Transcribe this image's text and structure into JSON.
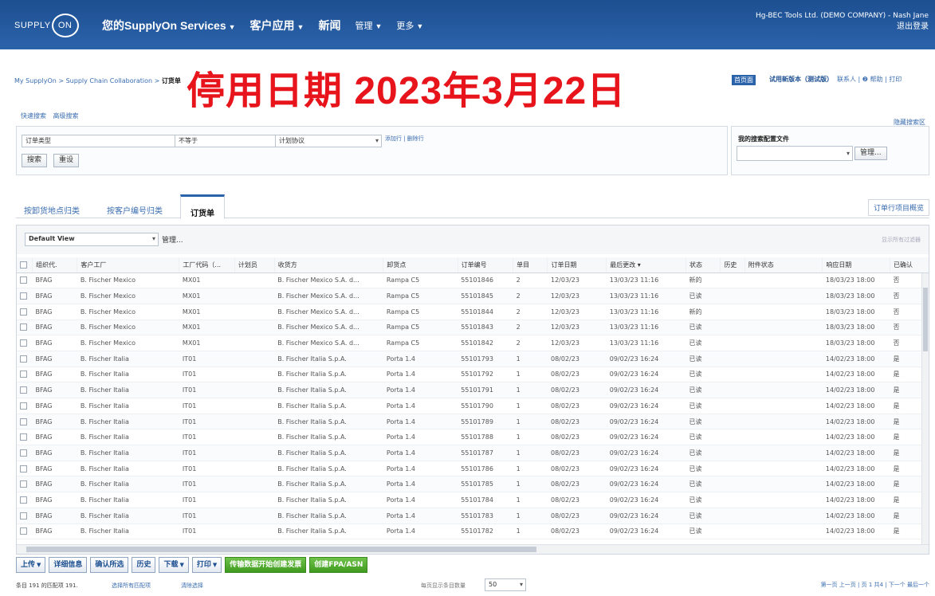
{
  "header": {
    "logo_text": "SUPPLY",
    "logo_ring": "ON",
    "nav": [
      {
        "label": "您的SupplyOn Services",
        "caret": "▼"
      },
      {
        "label": "客户应用",
        "caret": "▼"
      },
      {
        "label": "新闻",
        "caret": ""
      },
      {
        "label": "管理",
        "caret": "▼"
      },
      {
        "label": "更多",
        "caret": "▼"
      }
    ],
    "user": "Hg-BEC Tools Ltd. (DEMO COMPANY) - Nash Jane",
    "logout": "退出登录"
  },
  "breadcrumb": {
    "path": "My SupplyOn > Supply Chain Collaboration > ",
    "current": "订货单"
  },
  "banner": "停用日期 2023年3月22日",
  "crumb_right": {
    "home": "首页面",
    "trial": "试用新版本（测试版）",
    "links": "联系人 | ❷ 帮助 | 打印"
  },
  "search_tabs": [
    "快速搜索",
    "高级搜索"
  ],
  "saved_search": "隐藏搜索区",
  "filter": {
    "field": "订单类型",
    "operator": "不等于",
    "value": "计划协议",
    "add_remove": "添加行 | 删除行",
    "search_btn": "搜索",
    "reset_btn": "重设"
  },
  "profile": {
    "label": "我的搜索配置文件",
    "value": "",
    "manage": "管理..."
  },
  "tabs": [
    {
      "label": "按卸货地点归类"
    },
    {
      "label": "按客户编号归类"
    },
    {
      "label": "订货单"
    }
  ],
  "order_lines_btn": "订单行项目概览",
  "view": {
    "selected": "Default View",
    "manage": "管理...",
    "right_hint": "显示所有过滤器"
  },
  "columns": [
    "组织代.",
    "客户工厂",
    "工厂代码（...",
    "计划员",
    "收货方",
    "卸货点",
    "订单编号",
    "单目",
    "订单日期",
    "最后更改 ▾",
    "状态",
    "历史",
    "附件状态",
    "响应日期",
    "已确认"
  ],
  "rows": [
    [
      "BFAG",
      "B. Fischer Mexico",
      "MX01",
      "",
      "B. Fischer Mexico S.A. d...",
      "Rampa C5",
      "55101846",
      "2",
      "12/03/23",
      "13/03/23 11:16",
      "新的",
      "",
      "",
      "18/03/23 18:00",
      "否"
    ],
    [
      "BFAG",
      "B. Fischer Mexico",
      "MX01",
      "",
      "B. Fischer Mexico S.A. d...",
      "Rampa C5",
      "55101845",
      "2",
      "12/03/23",
      "13/03/23 11:16",
      "已读",
      "",
      "",
      "18/03/23 18:00",
      "否"
    ],
    [
      "BFAG",
      "B. Fischer Mexico",
      "MX01",
      "",
      "B. Fischer Mexico S.A. d...",
      "Rampa C5",
      "55101844",
      "2",
      "12/03/23",
      "13/03/23 11:16",
      "新的",
      "",
      "",
      "18/03/23 18:00",
      "否"
    ],
    [
      "BFAG",
      "B. Fischer Mexico",
      "MX01",
      "",
      "B. Fischer Mexico S.A. d...",
      "Rampa C5",
      "55101843",
      "2",
      "12/03/23",
      "13/03/23 11:16",
      "已读",
      "",
      "",
      "18/03/23 18:00",
      "否"
    ],
    [
      "BFAG",
      "B. Fischer Mexico",
      "MX01",
      "",
      "B. Fischer Mexico S.A. d...",
      "Rampa C5",
      "55101842",
      "2",
      "12/03/23",
      "13/03/23 11:16",
      "已读",
      "",
      "",
      "18/03/23 18:00",
      "否"
    ],
    [
      "BFAG",
      "B. Fischer Italia",
      "IT01",
      "",
      "B. Fischer Italia S.p.A.",
      "Porta 1.4",
      "55101793",
      "1",
      "08/02/23",
      "09/02/23 16:24",
      "已读",
      "",
      "",
      "14/02/23 18:00",
      "是"
    ],
    [
      "BFAG",
      "B. Fischer Italia",
      "IT01",
      "",
      "B. Fischer Italia S.p.A.",
      "Porta 1.4",
      "55101792",
      "1",
      "08/02/23",
      "09/02/23 16:24",
      "已读",
      "",
      "",
      "14/02/23 18:00",
      "是"
    ],
    [
      "BFAG",
      "B. Fischer Italia",
      "IT01",
      "",
      "B. Fischer Italia S.p.A.",
      "Porta 1.4",
      "55101791",
      "1",
      "08/02/23",
      "09/02/23 16:24",
      "已读",
      "",
      "",
      "14/02/23 18:00",
      "是"
    ],
    [
      "BFAG",
      "B. Fischer Italia",
      "IT01",
      "",
      "B. Fischer Italia S.p.A.",
      "Porta 1.4",
      "55101790",
      "1",
      "08/02/23",
      "09/02/23 16:24",
      "已读",
      "",
      "",
      "14/02/23 18:00",
      "是"
    ],
    [
      "BFAG",
      "B. Fischer Italia",
      "IT01",
      "",
      "B. Fischer Italia S.p.A.",
      "Porta 1.4",
      "55101789",
      "1",
      "08/02/23",
      "09/02/23 16:24",
      "已读",
      "",
      "",
      "14/02/23 18:00",
      "是"
    ],
    [
      "BFAG",
      "B. Fischer Italia",
      "IT01",
      "",
      "B. Fischer Italia S.p.A.",
      "Porta 1.4",
      "55101788",
      "1",
      "08/02/23",
      "09/02/23 16:24",
      "已读",
      "",
      "",
      "14/02/23 18:00",
      "是"
    ],
    [
      "BFAG",
      "B. Fischer Italia",
      "IT01",
      "",
      "B. Fischer Italia S.p.A.",
      "Porta 1.4",
      "55101787",
      "1",
      "08/02/23",
      "09/02/23 16:24",
      "已读",
      "",
      "",
      "14/02/23 18:00",
      "是"
    ],
    [
      "BFAG",
      "B. Fischer Italia",
      "IT01",
      "",
      "B. Fischer Italia S.p.A.",
      "Porta 1.4",
      "55101786",
      "1",
      "08/02/23",
      "09/02/23 16:24",
      "已读",
      "",
      "",
      "14/02/23 18:00",
      "是"
    ],
    [
      "BFAG",
      "B. Fischer Italia",
      "IT01",
      "",
      "B. Fischer Italia S.p.A.",
      "Porta 1.4",
      "55101785",
      "1",
      "08/02/23",
      "09/02/23 16:24",
      "已读",
      "",
      "",
      "14/02/23 18:00",
      "是"
    ],
    [
      "BFAG",
      "B. Fischer Italia",
      "IT01",
      "",
      "B. Fischer Italia S.p.A.",
      "Porta 1.4",
      "55101784",
      "1",
      "08/02/23",
      "09/02/23 16:24",
      "已读",
      "",
      "",
      "14/02/23 18:00",
      "是"
    ],
    [
      "BFAG",
      "B. Fischer Italia",
      "IT01",
      "",
      "B. Fischer Italia S.p.A.",
      "Porta 1.4",
      "55101783",
      "1",
      "08/02/23",
      "09/02/23 16:24",
      "已读",
      "",
      "",
      "14/02/23 18:00",
      "是"
    ],
    [
      "BFAG",
      "B. Fischer Italia",
      "IT01",
      "",
      "B. Fischer Italia S.p.A.",
      "Porta 1.4",
      "55101782",
      "1",
      "08/02/23",
      "09/02/23 16:24",
      "已读",
      "",
      "",
      "14/02/23 18:00",
      "是"
    ]
  ],
  "actions": [
    {
      "label": "上传",
      "caret": "▼",
      "style": "normal"
    },
    {
      "label": "详细信息",
      "caret": "",
      "style": "normal"
    },
    {
      "label": "确认所选",
      "caret": "",
      "style": "normal"
    },
    {
      "label": "历史",
      "caret": "",
      "style": "normal"
    },
    {
      "label": "下载",
      "caret": "▼",
      "style": "normal"
    },
    {
      "label": "打印",
      "caret": "▼",
      "style": "normal"
    },
    {
      "label": "传输数据开始创建发票",
      "caret": "",
      "style": "green"
    },
    {
      "label": "创建FPA/ASN",
      "caret": "",
      "style": "green"
    }
  ],
  "footer": {
    "count": "条目 191 的匹配项 191.",
    "select_all": "选择所有匹配项",
    "clear": "清除选择",
    "per_page_label": "每页显示条目数量",
    "per_page": "50",
    "pager": "第一页  上一页  |  页  1  共4  |  下一个  最后一个"
  },
  "colors": {
    "header_bg": "#1d4f91",
    "banner": "#e8141c",
    "link": "#3a6db0",
    "green_button": "#3f9b1f"
  }
}
